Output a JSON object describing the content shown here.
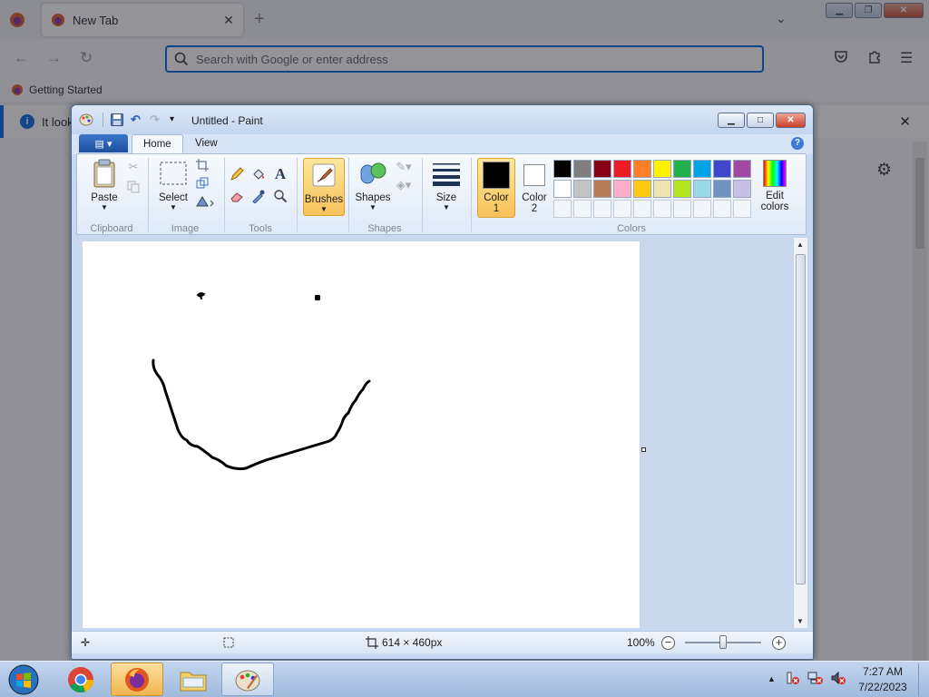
{
  "firefox": {
    "tab_title": "New Tab",
    "search_placeholder": "Search with Google or enter address",
    "bookmark_label": "Getting Started",
    "notice_text": "It look"
  },
  "paint": {
    "title": "Untitled - Paint",
    "tabs": [
      "Home",
      "View"
    ],
    "groups": {
      "clipboard": "Clipboard",
      "image": "Image",
      "tools": "Tools",
      "shapes": "Shapes",
      "colors": "Colors"
    },
    "buttons": {
      "paste": "Paste",
      "select": "Select",
      "brushes": "Brushes",
      "shapes": "Shapes",
      "size": "Size",
      "color1_line1": "Color",
      "color1_line2": "1",
      "color2_line1": "Color",
      "color2_line2": "2",
      "edit_colors_line1": "Edit",
      "edit_colors_line2": "colors"
    },
    "color1": "#000000",
    "color2": "#ffffff",
    "palette": [
      "#000000",
      "#7f7f7f",
      "#880015",
      "#ed1c24",
      "#ff7f27",
      "#fff200",
      "#22b14c",
      "#00a2e8",
      "#3f48cc",
      "#a349a4",
      "#ffffff",
      "#c3c3c3",
      "#b97a57",
      "#ffaec9",
      "#ffc90e",
      "#efe4b0",
      "#b5e61d",
      "#99d9ea",
      "#7092be",
      "#c8bfe7"
    ],
    "status": {
      "canvas_size": "614 × 460px",
      "zoom": "100%"
    }
  },
  "taskbar": {
    "time": "7:27 AM",
    "date": "7/22/2023"
  }
}
